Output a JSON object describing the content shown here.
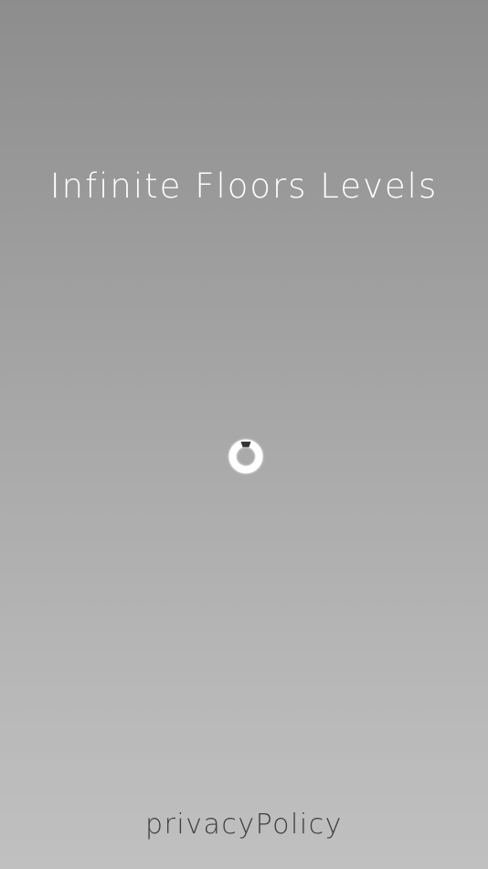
{
  "screen": {
    "title": "Infinite Floors Levels",
    "privacy_link": "privacyPolicy"
  },
  "loader": {
    "icon": "loading-ring-icon",
    "ring_color": "#ffffff",
    "marker_color": "#333333"
  },
  "colors": {
    "background_top": "#8d8d8d",
    "background_bottom": "#c0c0c0",
    "title_text": "#ffffff",
    "link_text": "#3f3f3f"
  }
}
